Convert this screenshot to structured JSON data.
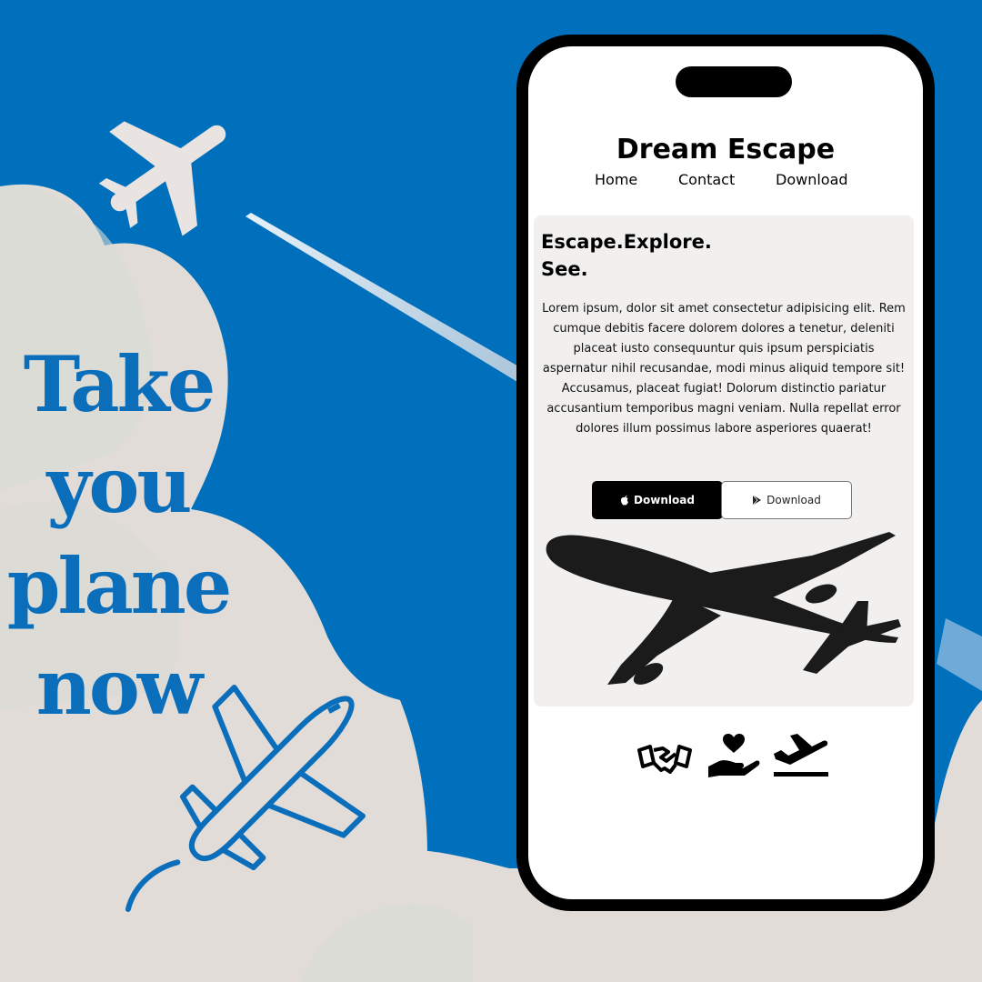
{
  "poster": {
    "headline": [
      "Take",
      "you",
      "plane",
      "now"
    ]
  },
  "app": {
    "title": "Dream Escape",
    "nav": [
      "Home",
      "Contact",
      "Download"
    ],
    "hero": {
      "heading_line1": "Escape.Explore.",
      "heading_line2": "See.",
      "body": "Lorem ipsum, dolor sit amet consectetur adipisicing elit. Rem cumque debitis facere dolorem dolores a tenetur, deleniti placeat iusto consequuntur quis ipsum perspiciatis aspernatur nihil recusandae, modi minus aliquid tempore sit! Accusamus, placeat fugiat! Dolorum distinctio pariatur accusantium temporibus magni veniam. Nulla repellat error dolores illum possimus labore asperiores quaerat!",
      "apple_download_label": "Download",
      "play_download_label": "Download"
    },
    "feature_icons": [
      "handshake-icon",
      "hand-heart-icon",
      "plane-departure-icon"
    ]
  },
  "colors": {
    "background": "#0070BD",
    "headline": "#0A6EBB",
    "cloud": "#E2DCD9",
    "phone_frame": "#000000",
    "card": "#F1F0EF"
  }
}
